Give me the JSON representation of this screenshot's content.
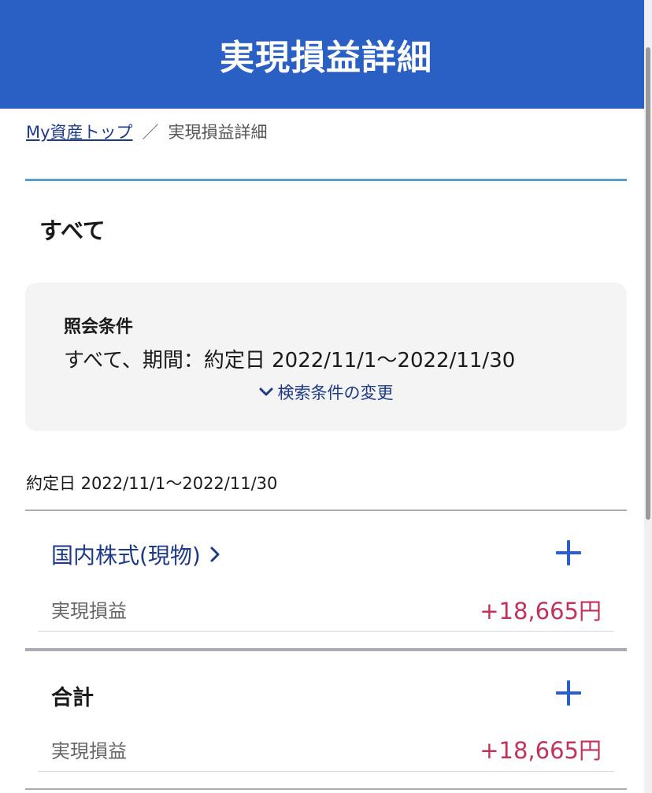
{
  "header": {
    "title": "実現損益詳細"
  },
  "breadcrumb": {
    "home_label": "My資産トップ",
    "separator": "／",
    "current": "実現損益詳細"
  },
  "section": {
    "title": "すべて"
  },
  "conditions": {
    "label": "照会条件",
    "text": "すべて、期間：約定日 2022/11/1〜2022/11/30",
    "change_label": "検索条件の変更"
  },
  "period": {
    "text": "約定日 2022/11/1〜2022/11/30"
  },
  "category": {
    "name": "国内株式(現物)",
    "row_label": "実現損益",
    "row_value": "+18,665円"
  },
  "total": {
    "name": "合計",
    "row_label": "実現損益",
    "row_value": "+18,665円"
  },
  "colors": {
    "header_bg": "#2a5fc4",
    "link": "#1d3a8a",
    "profit": "#c2335a",
    "accent_rule": "#5aa0cf"
  }
}
